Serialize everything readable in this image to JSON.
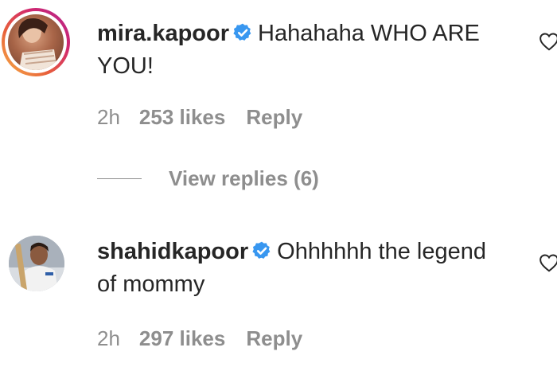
{
  "comments": [
    {
      "username": "mira.kapoor",
      "text": "Hahahaha WHO ARE YOU!",
      "time": "2h",
      "likes": "253 likes",
      "reply_label": "Reply",
      "verified": true,
      "avatar_story_ring": true
    },
    {
      "username": "shahidkapoor",
      "text": "Ohhhhhh the legend of mommy",
      "time": "2h",
      "likes": "297 likes",
      "reply_label": "Reply",
      "verified": true,
      "avatar_story_ring": false
    }
  ],
  "view_replies": {
    "label": "View replies (6)"
  },
  "icons": {
    "verified": "verified-badge-icon",
    "like": "heart-outline-icon"
  },
  "colors": {
    "text": "#262626",
    "muted": "#8e8e8e",
    "verified_blue": "#3897f0"
  }
}
